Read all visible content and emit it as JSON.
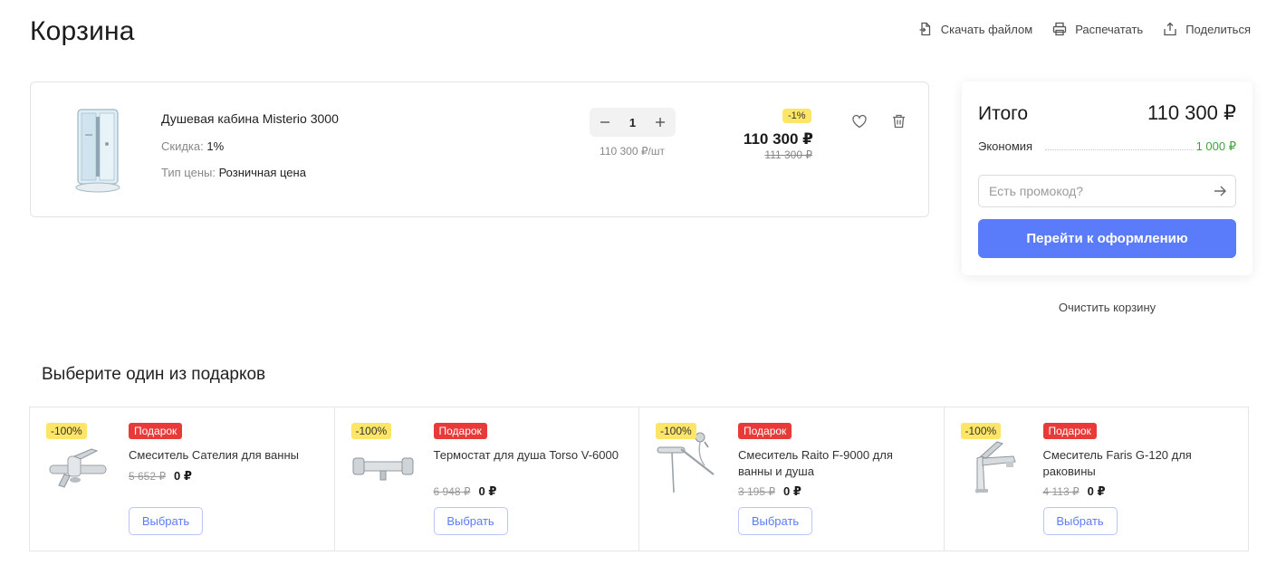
{
  "page": {
    "title": "Корзина"
  },
  "top_actions": [
    {
      "label": "Скачать файлом",
      "icon": "download-file-icon"
    },
    {
      "label": "Распечатать",
      "icon": "printer-icon"
    },
    {
      "label": "Поделиться",
      "icon": "share-icon"
    }
  ],
  "cart": {
    "items": [
      {
        "name": "Душевая кабина Misterio 3000",
        "discount_label": "Скидка:",
        "discount_value": "1%",
        "price_type_label": "Тип цены:",
        "price_type_value": "Розничная цена",
        "quantity": "1",
        "unit_price": "110 300 ₽/шт",
        "badge": "-1%",
        "price": "110 300 ₽",
        "old_price": "111 300 ₽"
      }
    ]
  },
  "summary": {
    "total_label": "Итого",
    "total_value": "110 300 ₽",
    "savings_label": "Экономия",
    "savings_value": "1 000 ₽",
    "promo_placeholder": "Есть промокод?",
    "checkout_label": "Перейти к оформлению"
  },
  "clear_cart_label": "Очистить корзину",
  "gifts": {
    "title": "Выберите один из подарков",
    "items": [
      {
        "badge": "-100%",
        "tag": "Подарок",
        "name": "Смеситель Сателия для ванны",
        "old_price": "5 652 ₽",
        "price": "0 ₽",
        "button": "Выбрать"
      },
      {
        "badge": "-100%",
        "tag": "Подарок",
        "name": "Термостат для душа Torso V-6000",
        "old_price": "6 948 ₽",
        "price": "0 ₽",
        "button": "Выбрать"
      },
      {
        "badge": "-100%",
        "tag": "Подарок",
        "name": "Смеситель Raito F-9000 для ванны и душа",
        "old_price": "3 195 ₽",
        "price": "0 ₽",
        "button": "Выбрать"
      },
      {
        "badge": "-100%",
        "tag": "Подарок",
        "name": "Смеситель Faris G-120 для раковины",
        "old_price": "4 113 ₽",
        "price": "0 ₽",
        "button": "Выбрать"
      }
    ]
  },
  "colors": {
    "accent": "#5b7cfa",
    "badge_yellow": "#fde567",
    "gift_red": "#e93a3a",
    "savings_green": "#3ba53b"
  }
}
